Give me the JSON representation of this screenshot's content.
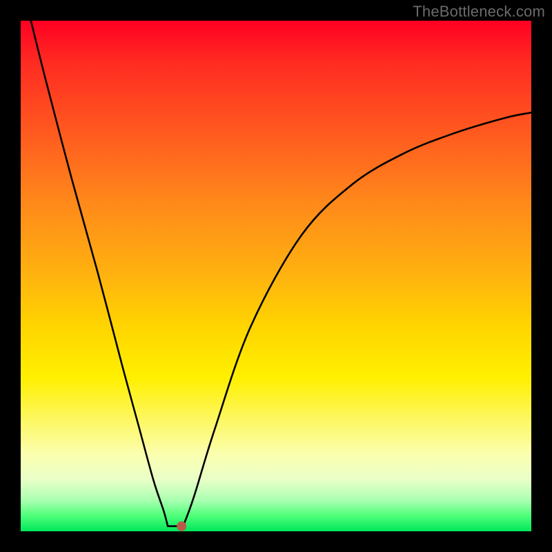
{
  "attribution": "TheBottleneck.com",
  "colors": {
    "frame": "#000000",
    "attribution_text": "#6b6b6b",
    "curve": "#000000",
    "marker": "#b95a4a",
    "gradient_stops": [
      "#ff0022",
      "#ff2a22",
      "#ff5a1f",
      "#ff8a1a",
      "#ffb30f",
      "#ffd500",
      "#fff000",
      "#fdf760",
      "#fbffb0",
      "#e8ffc8",
      "#a8ffb0",
      "#4dff78",
      "#00e65c"
    ]
  },
  "chart_data": {
    "type": "line",
    "title": "",
    "xlabel": "",
    "ylabel": "",
    "xlim": [
      0,
      100
    ],
    "ylim": [
      0,
      100
    ],
    "grid": false,
    "series": [
      {
        "name": "curve",
        "x": [
          2,
          5,
          10,
          15,
          20,
          23,
          26,
          28,
          30,
          31,
          31.5,
          32,
          34,
          38,
          45,
          55,
          65,
          75,
          85,
          95,
          100
        ],
        "y": [
          100,
          88,
          69,
          51,
          32,
          21,
          10,
          4,
          1.5,
          1,
          1,
          1.5,
          7,
          20,
          40,
          58,
          68,
          74,
          78,
          81,
          82
        ]
      }
    ],
    "minimum_point": {
      "x": 31.5,
      "y": 1
    },
    "flat_segment": {
      "x_start": 28.8,
      "x_end": 31.5,
      "y": 1
    }
  }
}
